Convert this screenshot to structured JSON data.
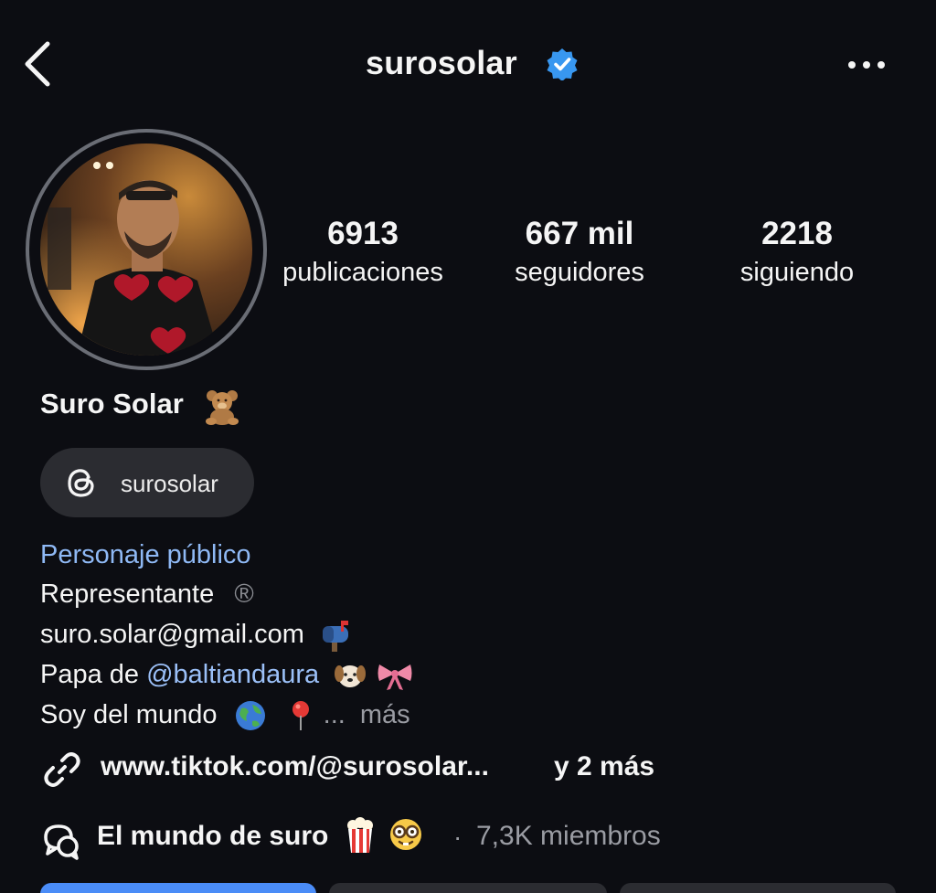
{
  "header": {
    "username": "surosolar",
    "verified_color": "#3897f0"
  },
  "stats": [
    {
      "value": "6913",
      "label": "publicaciones"
    },
    {
      "value": "667 mil",
      "label": "seguidores"
    },
    {
      "value": "2218",
      "label": "siguiendo"
    }
  ],
  "profile": {
    "display_name": "Suro Solar",
    "threads_handle": "surosolar",
    "category": "Personaje público",
    "bio": {
      "line1": "Representante",
      "line1_symbol": "®",
      "email": "suro.solar@gmail.com",
      "line3_prefix": "Papa de",
      "mention": "@baltiandaura",
      "line4": "Soy del mundo",
      "ellipsis": "...",
      "more": "más"
    },
    "link": {
      "text": "www.tiktok.com/@surosolar...",
      "more": "y 2 más"
    },
    "channel": {
      "name": "El mundo de suro",
      "separator": "·",
      "members": "7,3K miembros"
    }
  },
  "icons": {
    "back": "chevron-left-icon",
    "more": "ellipsis-icon",
    "verified": "verified-badge-icon",
    "threads": "threads-icon",
    "link": "link-icon",
    "channel": "broadcast-channel-icon"
  },
  "colors": {
    "background": "#0c0d12",
    "chip": "#2b2c31",
    "category": "#8fb9f5",
    "mention": "#9bc0f8",
    "muted": "#9a9ca3",
    "follow_button": "#4a8cf7"
  }
}
